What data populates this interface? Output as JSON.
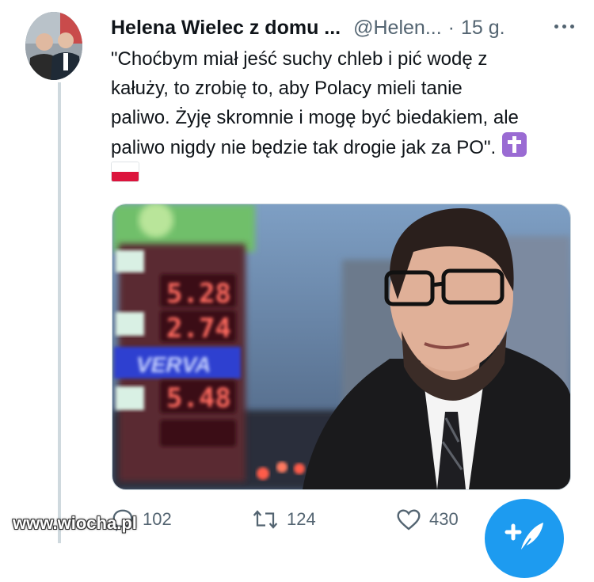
{
  "tweet": {
    "display_name": "Helena Wielec z domu ...",
    "handle": "@Helen...",
    "separator": "·",
    "time": "15 g.",
    "text_lines": [
      "\"Choćbym miał jeść suchy chleb i pić wodę z",
      "kałuży, to zrobię to, aby Polacy mieli tanie",
      "paliwo. Żyję skromnie i mogę być biedakiem, ale",
      "paliwo nigdy nie będzie tak drogie jak za PO\"."
    ],
    "emojis": [
      "latin-cross",
      "flag-poland"
    ]
  },
  "media": {
    "price_board": [
      "5.28",
      "2.74",
      "5.48"
    ],
    "brand_sign": "VERVA"
  },
  "actions": {
    "reply_count": "102",
    "retweet_count": "124",
    "like_count": "430"
  },
  "watermark": "www.wiocha.pl",
  "colors": {
    "accent": "#1d9bf0",
    "secondary_text": "#536471",
    "thread_line": "#cfd9de"
  }
}
